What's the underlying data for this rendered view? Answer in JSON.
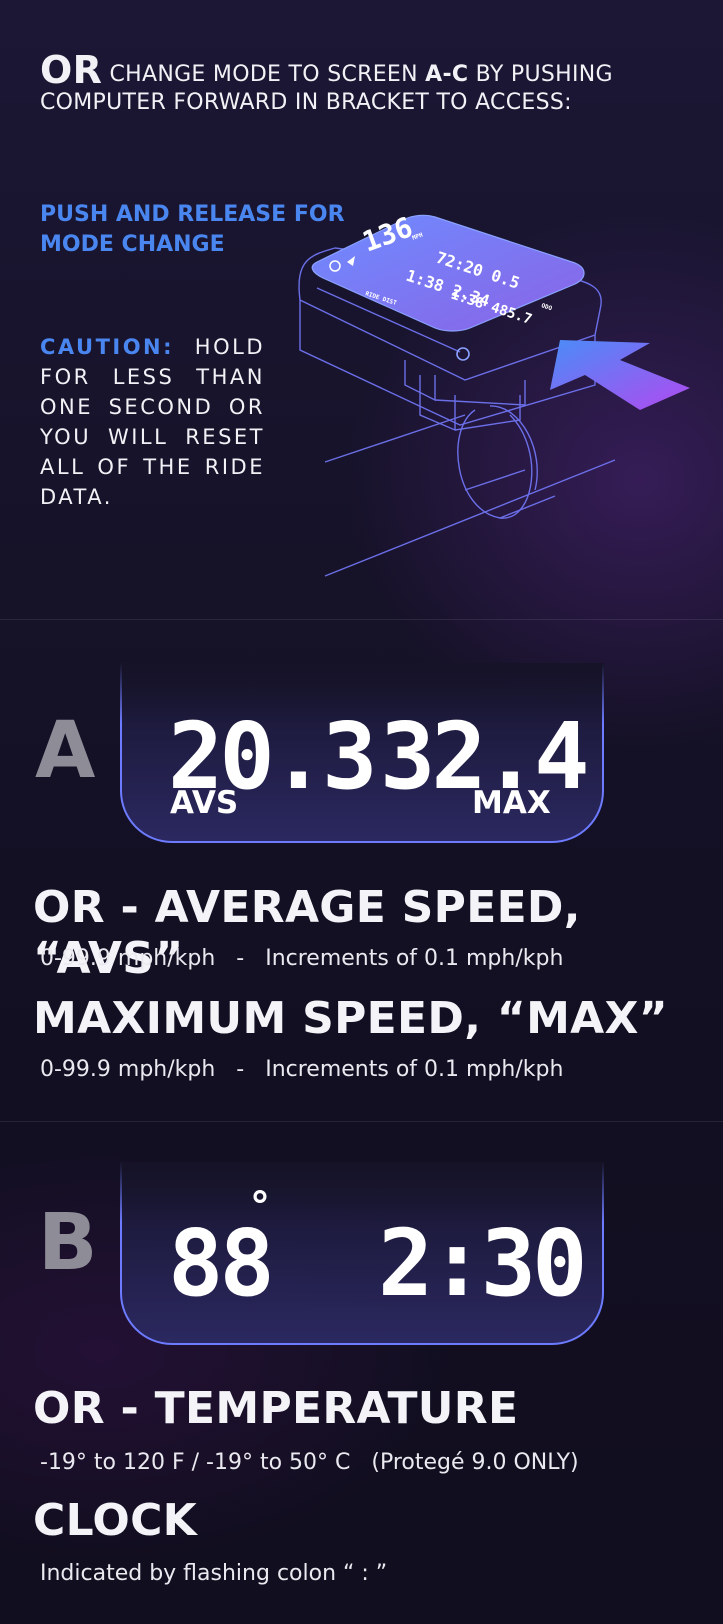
{
  "intro": {
    "or": "OR",
    "text_1": "CHANGE MODE TO SCREEN",
    "screen_range": "A-C",
    "text_2": "BY PUSHING COMPUTER FORWARD IN BRACKET TO ACCESS:"
  },
  "push_label": "PUSH AND RELEASE FOR MODE CHANGE",
  "caution": {
    "label": "CAUTION:",
    "text": "HOLD FOR LESS THAN ONE SECOND OR YOU WILL RESET ALL OF THE RIDE DATA."
  },
  "device": {
    "speed": "136",
    "speed_unit": "MPH",
    "row2": "72:20 0.5",
    "row3": "1:38 2.34",
    "row4": "1:38 485.7",
    "small_left": "RIDE DIST",
    "small_right": "ODO"
  },
  "screen_a": {
    "letter": "A",
    "value_left": "20.3",
    "value_right": "32.4",
    "label_left": "AVS",
    "label_right": "MAX",
    "heading_1": "OR - AVERAGE SPEED, “AVS”",
    "detail_1": "0-99.9 mph/kph   -   Increments of 0.1 mph/kph",
    "heading_2": "MAXIMUM SPEED, “MAX”",
    "detail_2": "0-99.9 mph/kph   -   Increments of 0.1 mph/kph"
  },
  "screen_b": {
    "letter": "B",
    "value_left": "88",
    "degree": "°",
    "value_right": "2:30",
    "heading_1": "OR - TEMPERATURE",
    "detail_1": "-19° to 120 F / -19° to 50° C   (Protegé 9.0 ONLY)",
    "heading_2": "CLOCK",
    "detail_2": "Indicated by flashing colon “ : ”"
  },
  "colors": {
    "accent_blue": "#4a86f0",
    "panel_border": "#6c7bff",
    "arrow_start": "#4a8cf7",
    "arrow_end": "#b14af0"
  }
}
